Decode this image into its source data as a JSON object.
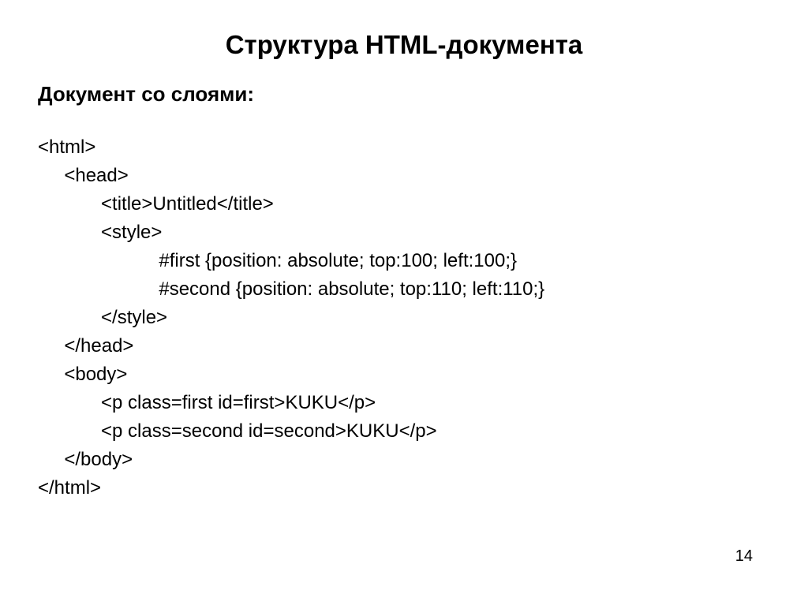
{
  "title": "Структура HTML-документа",
  "subtitle": "Документ со слоями:",
  "code": {
    "line1": "<html>",
    "line2": "     <head>",
    "line3": "            <title>Untitled</title>",
    "line4": "            <style>",
    "line5": "                       #first {position: absolute; top:100; left:100;}",
    "line6": "                       #second {position: absolute; top:110; left:110;}",
    "line7": "            </style>",
    "line8": "     </head>",
    "line9": "     <body>",
    "line10": "            <p class=first id=first>KUKU</p>",
    "line11": "            <p class=second id=second>KUKU</p>",
    "line12": "     </body>",
    "line13": "</html>"
  },
  "page_number": "14"
}
